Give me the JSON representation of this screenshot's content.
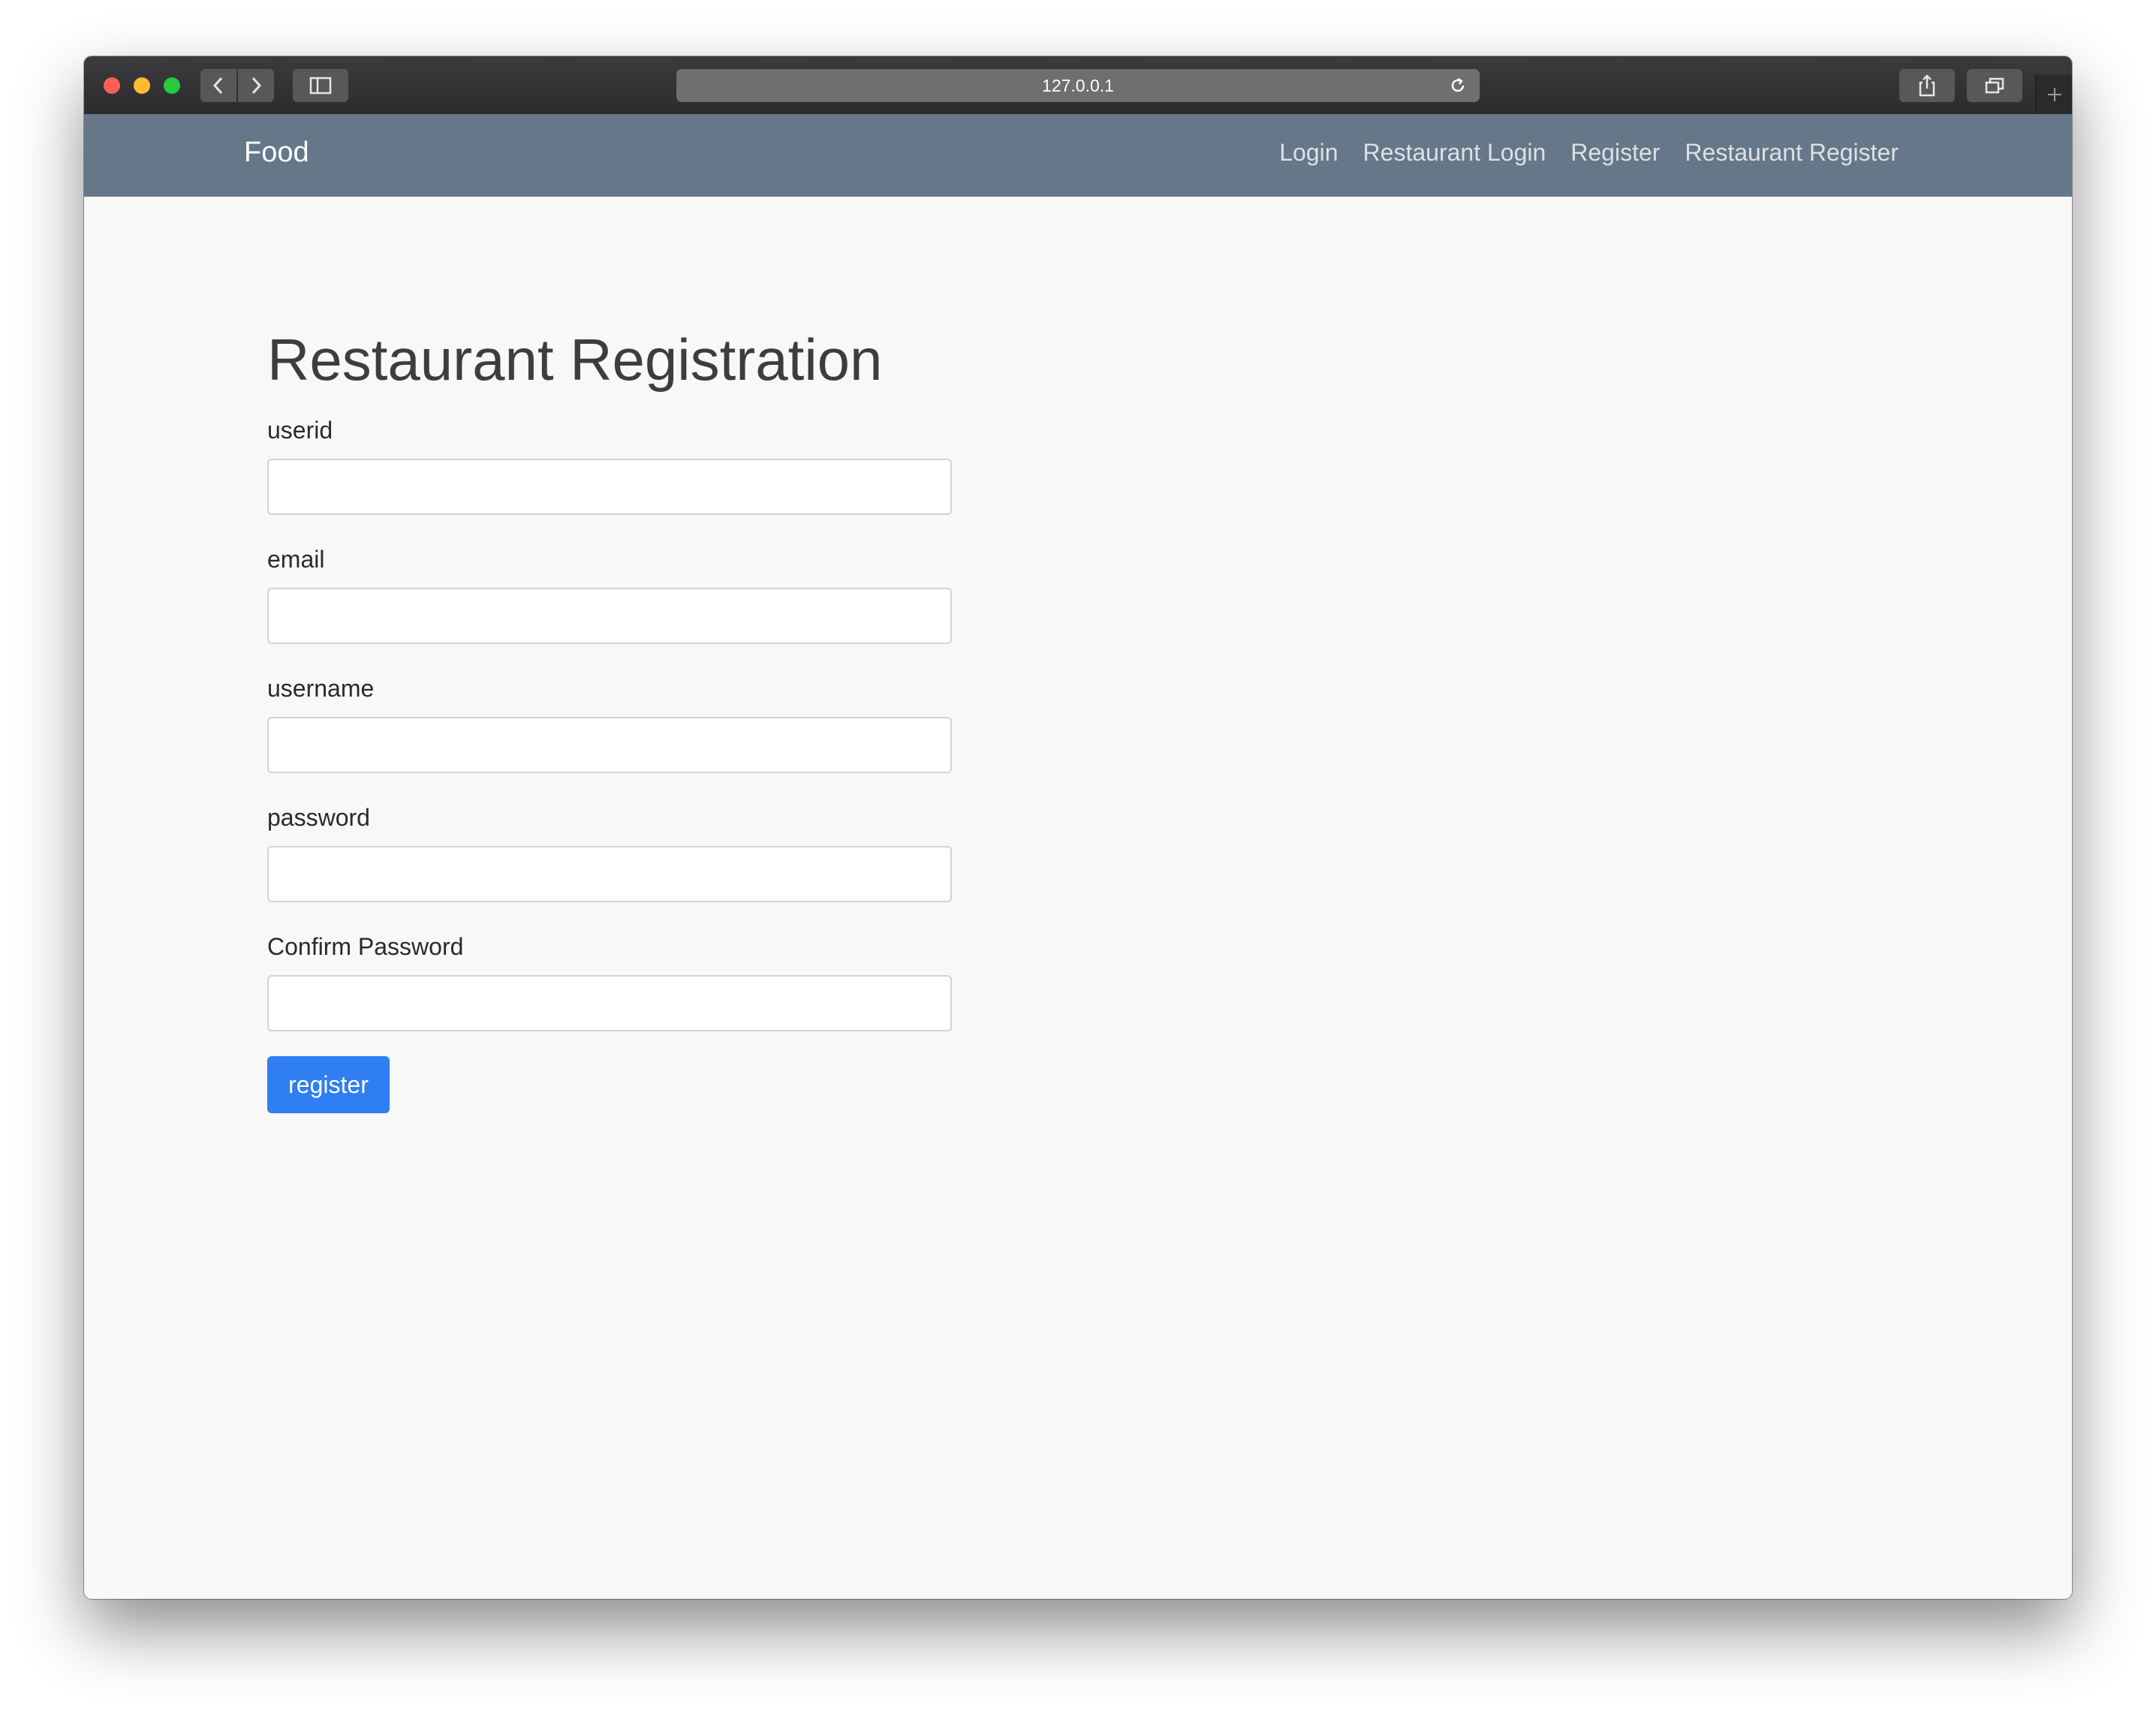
{
  "browser": {
    "url": "127.0.0.1",
    "icons": {
      "back": "chevron-left-icon",
      "forward": "chevron-right-icon",
      "sidebar": "sidebar-icon",
      "reload": "reload-icon",
      "share": "share-icon",
      "tabs": "tabs-icon",
      "new_tab": "plus-icon"
    }
  },
  "navbar": {
    "brand": "Food",
    "links": [
      {
        "label": "Login"
      },
      {
        "label": "Restaurant Login"
      },
      {
        "label": "Register"
      },
      {
        "label": "Restaurant Register"
      }
    ],
    "background_color": "#657788"
  },
  "form": {
    "title": "Restaurant Registration",
    "fields": [
      {
        "label": "userid",
        "value": ""
      },
      {
        "label": "email",
        "value": ""
      },
      {
        "label": "username",
        "value": ""
      },
      {
        "label": "password",
        "value": ""
      },
      {
        "label": "Confirm Password",
        "value": ""
      }
    ],
    "submit_label": "register",
    "submit_color": "#2f7ef3"
  }
}
